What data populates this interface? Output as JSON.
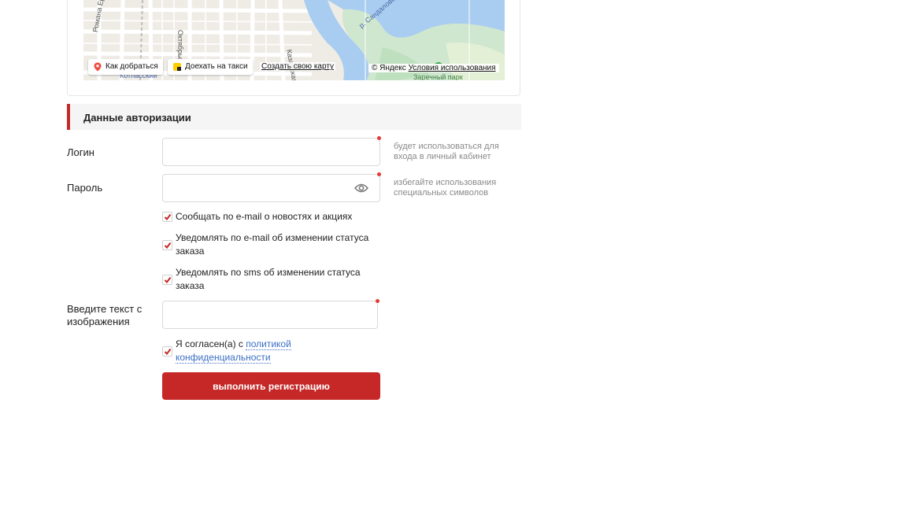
{
  "map": {
    "streets": [
      "Романа Ердякова",
      "Октябрьская",
      "Котласский",
      "Заречный парк",
      "р. Сандаловка",
      "Казанская"
    ],
    "route_button": "Как добраться",
    "taxi_button": "Доехать на такси",
    "create_map_link": "Создать свою карту",
    "copyright": "© Яндекс",
    "terms_link": "Условия использования"
  },
  "auth": {
    "section_title": "Данные авторизации",
    "login_label": "Логин",
    "login_hint": "будет использоваться для входа в личный кабинет",
    "password_label": "Пароль",
    "password_hint": "избегайте использования специальных символов",
    "checkbox_news": "Сообщать по e-mail о новостях и акциях",
    "checkbox_email_status": "Уведомлять по e-mail об изменении статуса заказа",
    "checkbox_sms_status": "Уведомлять по sms об изменении статуса заказа",
    "captcha_label": "Введите текст с изображения",
    "agree_text": "Я согласен(а) с ",
    "agree_link": "политикой конфиденциальности",
    "submit_label": "выполнить регистрацию"
  },
  "colors": {
    "accent": "#c62828",
    "required_dot": "#e53935",
    "link": "#3a6fc4"
  }
}
